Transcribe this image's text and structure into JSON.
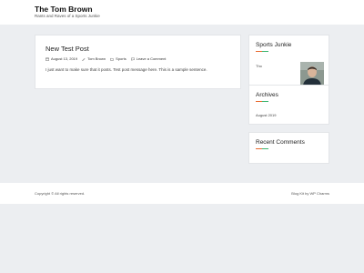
{
  "header": {
    "title": "The Tom Brown",
    "tagline": "Rants and Raves of a Sports Junkie"
  },
  "post": {
    "title": "New Test Post",
    "date": "August 13, 2019",
    "author": "Tom Brown",
    "category": "Sports",
    "comment_link": "Leave a Comment",
    "excerpt": "I just want to make sure that it posts. Test post message here. This is a sample sentence."
  },
  "sidebar": {
    "sports": {
      "title": "Sports Junkie",
      "text": "Tho"
    },
    "archives": {
      "title": "Archives",
      "items": [
        "August 2019"
      ]
    },
    "recent_comments": {
      "title": "Recent Comments"
    }
  },
  "footer": {
    "copyright": "Copyright © All rights reserved.",
    "credit": "Blog Kit by WP Charms"
  },
  "colors": {
    "background": "#eceef1",
    "accent_orange": "#e8692e",
    "accent_green": "#3cb56f"
  }
}
